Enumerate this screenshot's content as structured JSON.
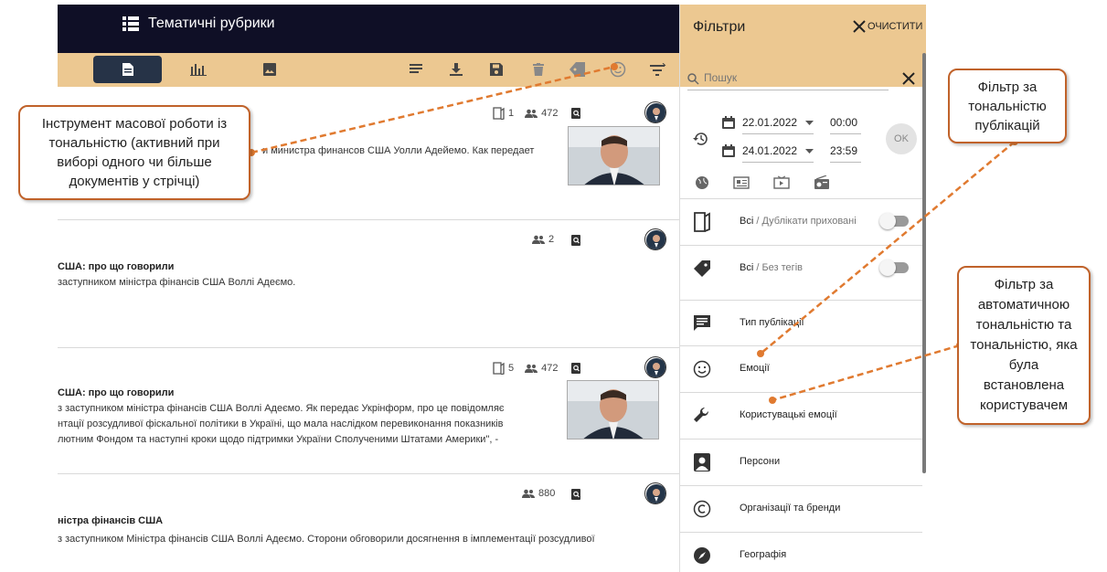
{
  "app": {
    "topbar_title": "Тематичні рубрики"
  },
  "toolbar": {
    "icons": [
      "document-icon",
      "chart-icon",
      "image-icon",
      "list-icon",
      "download-icon",
      "save-icon",
      "delete-icon",
      "tag-icon",
      "emotion-icon",
      "filter-icon"
    ]
  },
  "feed": {
    "items": [
      {
        "copies": "1",
        "audience": "472",
        "title": "",
        "lines": [
          "и министра финансов США Уолли Адейемо. Как передает"
        ],
        "has_thumb": true
      },
      {
        "copies": "",
        "audience": "2",
        "title": "США: про що говорили",
        "lines": [
          "заступником міністра фінансів США Воллі Адеємо."
        ],
        "has_thumb": false
      },
      {
        "copies": "5",
        "audience": "472",
        "title": "США: про що говорили",
        "lines": [
          "з заступником міністра фінансів США Воллі Адеємо. Як передає Укрінформ, про це повідомляє",
          "нтації розсудливої фіскальної політики в Україні, що мала наслідком перевиконання показників",
          "лютним Фондом та наступні кроки щодо підтримки України Сполученими Штатами Америки\", -"
        ],
        "has_thumb": true
      },
      {
        "copies": "",
        "audience": "880",
        "title": "ністра фінансів США",
        "lines": [
          "з заступником Міністра фінансів США Воллі Адеємо. Сторони обговорили досягнення в імплементації розсудливої"
        ],
        "has_thumb": false
      }
    ]
  },
  "filters": {
    "title": "Фільтри",
    "clear_label": "ОЧИСТИТИ",
    "search_placeholder": "Пошук",
    "date_from": "22.01.2022",
    "time_from": "00:00",
    "date_to": "24.01.2022",
    "time_to": "23:59",
    "ok_label": "OK",
    "rows": [
      {
        "icon": "duplicates-icon",
        "label": "Всі",
        "sub": " / Дублікати приховані",
        "toggle": true
      },
      {
        "icon": "tag-icon",
        "label": "Всі",
        "sub": " / Без тегів",
        "toggle": true
      },
      {
        "icon": "message-icon",
        "label": "Тип публікації",
        "sub": "",
        "toggle": false
      },
      {
        "icon": "emotion-icon",
        "label": "Емоції",
        "sub": "",
        "toggle": false
      },
      {
        "icon": "wrench-icon",
        "label": "Користувацькі емоції",
        "sub": "",
        "toggle": false
      },
      {
        "icon": "person-icon",
        "label": "Персони",
        "sub": "",
        "toggle": false
      },
      {
        "icon": "copyright-icon",
        "label": "Організації та бренди",
        "sub": "",
        "toggle": false
      },
      {
        "icon": "compass-icon",
        "label": "Географія",
        "sub": "",
        "toggle": false
      }
    ]
  },
  "callouts": {
    "mass_tool": "Інструмент масової роботи із тональністю (активний при виборі одного чи більше документів у стрічці)",
    "tone_filter": "Фільтр за тональністю публікацій",
    "auto_tone_filter": "Фільтр за автоматичною тональністю та тональністю, яка була встановлена користувачем"
  },
  "colors": {
    "topbar": "#0f0f26",
    "accent": "#ecc891",
    "callout_border": "#c0622a",
    "arrow": "#e07a30"
  }
}
